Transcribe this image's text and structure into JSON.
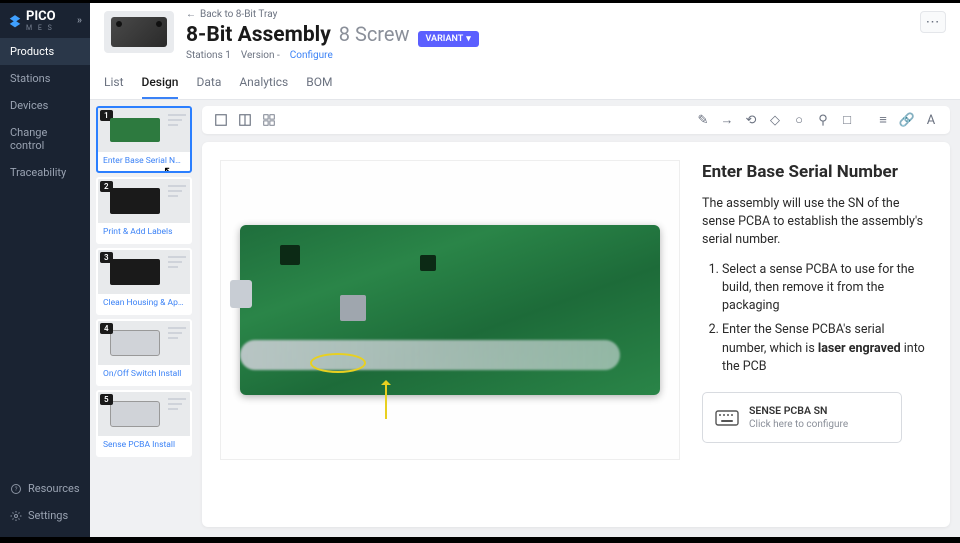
{
  "brand": "PICO",
  "brand_sub": "M E S",
  "sidebar": {
    "items": [
      {
        "label": "Products"
      },
      {
        "label": "Stations"
      },
      {
        "label": "Devices"
      },
      {
        "label": "Change control"
      },
      {
        "label": "Traceability"
      }
    ],
    "bottom": [
      {
        "label": "Resources"
      },
      {
        "label": "Settings"
      }
    ]
  },
  "header": {
    "back": "Back to 8-Bit Tray",
    "title": "8-Bit Assembly",
    "subtitle": "8 Screw",
    "variant_label": "VARIANT",
    "meta_stations": "Stations 1",
    "meta_version": "Version -",
    "meta_configure": "Configure",
    "tabs": [
      {
        "label": "List"
      },
      {
        "label": "Design"
      },
      {
        "label": "Data"
      },
      {
        "label": "Analytics"
      },
      {
        "label": "BOM"
      }
    ]
  },
  "steps": [
    {
      "num": "1",
      "label": "Enter Base Serial Number",
      "kind": "pcb"
    },
    {
      "num": "2",
      "label": "Print & Add Labels",
      "kind": "dark"
    },
    {
      "num": "3",
      "label": "Clean Housing & Apply L...",
      "kind": "dark"
    },
    {
      "num": "4",
      "label": "On/Off Switch Install",
      "kind": "light"
    },
    {
      "num": "5",
      "label": "Sense PCBA Install",
      "kind": "light"
    }
  ],
  "instructions": {
    "heading": "Enter Base Serial Number",
    "intro": "The assembly will use the SN of the sense PCBA to establish the assembly's serial number.",
    "list": [
      "Select a sense PCBA to use for the build, then remove it from the packaging",
      "Enter the Sense PCBA's serial number, which is laser engraved into the PCB"
    ],
    "config_title": "SENSE PCBA SN",
    "config_sub": "Click here to configure"
  }
}
